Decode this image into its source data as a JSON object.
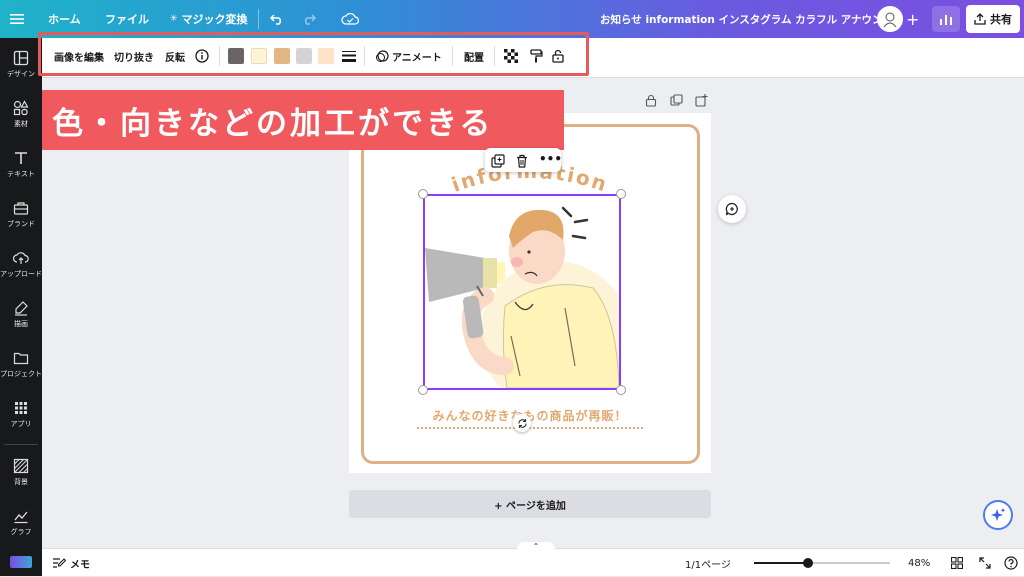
{
  "topbar": {
    "menu_icon": "hamburger-icon",
    "home": "ホーム",
    "file": "ファイル",
    "magic": "マジック変換",
    "title": "お知らせ information インスタグラム カラフル アナウンス",
    "share": "共有"
  },
  "sidebar": {
    "items": [
      {
        "label": "デザイン",
        "icon": "layout-icon"
      },
      {
        "label": "素材",
        "icon": "shapes-icon"
      },
      {
        "label": "テキスト",
        "icon": "text-icon"
      },
      {
        "label": "ブランド",
        "icon": "brand-icon"
      },
      {
        "label": "アップロード",
        "icon": "upload-icon"
      },
      {
        "label": "描画",
        "icon": "draw-icon"
      },
      {
        "label": "プロジェクト",
        "icon": "folder-icon"
      },
      {
        "label": "アプリ",
        "icon": "apps-icon"
      },
      {
        "label": "背景",
        "icon": "background-icon"
      },
      {
        "label": "グラフ",
        "icon": "chart-icon"
      }
    ]
  },
  "toolbar": {
    "edit_image": "画像を編集",
    "crop": "切り抜き",
    "flip": "反転",
    "animate": "アニメート",
    "position": "配置",
    "swatches": [
      "#6b6465",
      "#fff4d6",
      "#e2b585",
      "#d4d4d8",
      "#fde3c8"
    ]
  },
  "banner": {
    "text": "色・向きなどの加工ができる"
  },
  "design": {
    "heading": "information",
    "caption": "みんなの好きなもの商品が再販！"
  },
  "canvas": {
    "add_page": "+ ページを追加"
  },
  "bottombar": {
    "notes": "メモ",
    "page_count": "1/1ページ",
    "zoom": "48%"
  },
  "colors": {
    "accent_purple": "#8b3dff",
    "banner_red": "#f05a5e",
    "frame_tan": "#dfb084"
  }
}
